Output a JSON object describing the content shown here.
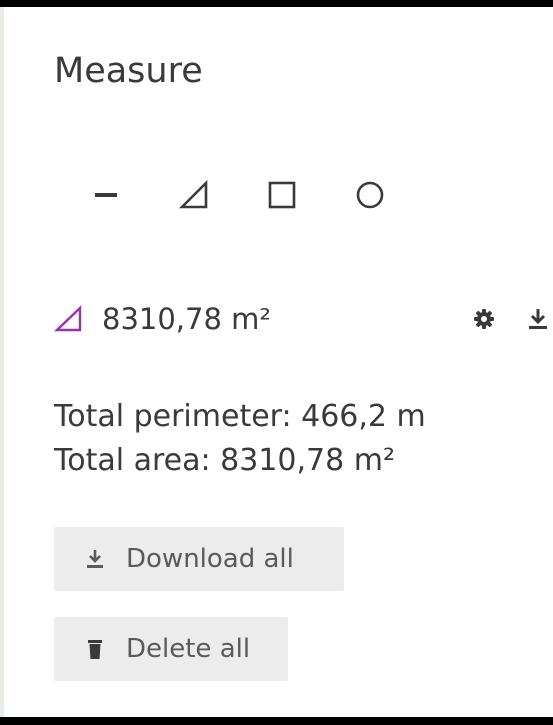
{
  "panel": {
    "title": "Measure"
  },
  "tools": [
    {
      "name": "line",
      "icon": "minus-icon"
    },
    {
      "name": "polygon",
      "icon": "triangle-icon"
    },
    {
      "name": "rectangle",
      "icon": "square-icon"
    },
    {
      "name": "circle",
      "icon": "circle-icon"
    }
  ],
  "measurement": {
    "icon": "triangle-icon",
    "icon_color": "#9b2fae",
    "value": "8310,78 m²",
    "actions": [
      "gear-icon",
      "download-icon"
    ]
  },
  "totals": {
    "perimeter": "Total perimeter: 466,2 m",
    "area": "Total area: 8310,78 m²"
  },
  "buttons": {
    "download_all": "Download all",
    "delete_all": "Delete all"
  },
  "colors": {
    "text": "#3a3a3a",
    "button_bg": "#ececec",
    "accent": "#9b2fae"
  }
}
